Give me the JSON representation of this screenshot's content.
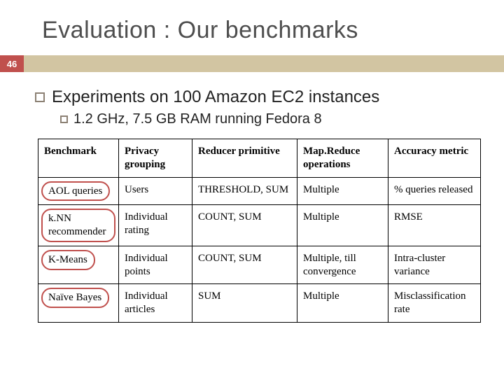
{
  "slide_number": "46",
  "title": "Evaluation : Our benchmarks",
  "bullet1": "Experiments on 100 Amazon EC2 instances",
  "bullet2": "1.2 GHz, 7.5 GB RAM running Fedora 8",
  "table": {
    "headers": [
      "Benchmark",
      "Privacy grouping",
      "Reducer primitive",
      "Map.Reduce operations",
      "Accuracy metric"
    ],
    "rows": [
      {
        "c0": "AOL queries",
        "c1": "Users",
        "c2": "THRESHOLD, SUM",
        "c3": "Multiple",
        "c4": "% queries released"
      },
      {
        "c0": "k.NN recommender",
        "c1": "Individual rating",
        "c2": "COUNT, SUM",
        "c3": "Multiple",
        "c4": "RMSE"
      },
      {
        "c0": "K-Means",
        "c1": "Individual points",
        "c2": "COUNT, SUM",
        "c3": "Multiple, till convergence",
        "c4": "Intra-cluster variance"
      },
      {
        "c0": "Naïve Bayes",
        "c1": "Individual articles",
        "c2": "SUM",
        "c3": "Multiple",
        "c4": "Misclassification rate"
      }
    ]
  }
}
